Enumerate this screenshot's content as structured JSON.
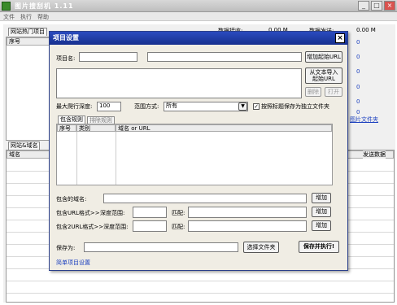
{
  "app": {
    "title": "图片搜刮机 1.11",
    "min": "_",
    "max": "□",
    "close": "×"
  },
  "menu": [
    "文件",
    "执行",
    "帮助"
  ],
  "panel_top": {
    "tab": "网站热门项目",
    "col_serial": "序号",
    "stats": [
      {
        "label": "数据接收:",
        "value": "0.00 M"
      },
      {
        "label": "数据发送:",
        "value": "0.00 M"
      }
    ],
    "right_values": [
      "0",
      "0",
      "0",
      "0",
      "0",
      "0"
    ],
    "link_text": "图片文件夹"
  },
  "panel_bottom": {
    "tab_site": "网站&域名",
    "col_domain": "域名",
    "col_send": "发送数据"
  },
  "dialog": {
    "title": "项目设置",
    "close": "×",
    "project_name_label": "项目名:",
    "project_name_value": "",
    "start_url_value": "",
    "add_url_btn": "增加起始URL",
    "import_btn": "从文本导入起始URL",
    "delete_btn": "删除",
    "open_btn": "打开",
    "depth_label": "最大爬行深度:",
    "depth_value": "100",
    "scope_label": "范围方式:",
    "scope_value": "所有",
    "save_by_title_label": "按照标题保存为独立文件夹",
    "save_by_title_checked": "✓",
    "tabs": [
      "包含规则",
      "排除规则"
    ],
    "rules_cols": [
      "序号",
      "类别",
      "域名 or URL"
    ],
    "include_domain_label": "包含的域名:",
    "include_url_label": "包含URL格式>>",
    "depth_range_label": "深度范围:",
    "match_label": "匹配:",
    "include_url2_label": "包含2URL格式>>深度范围:",
    "add_btn": "增加",
    "save_as_label": "保存为:",
    "save_as_value": "",
    "choose_folder_btn": "选择文件夹",
    "save_exec_btn": "保存并执行!",
    "simple_settings_link": "简单项目设置"
  }
}
